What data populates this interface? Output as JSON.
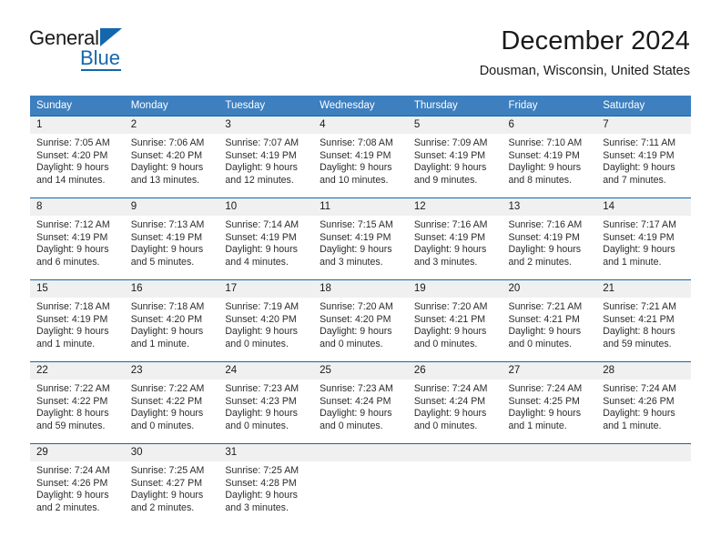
{
  "brand": {
    "name_top": "General",
    "name_bottom": "Blue",
    "accent_color": "#1567ac"
  },
  "header": {
    "title": "December 2024",
    "location": "Dousman, Wisconsin, United States"
  },
  "theme": {
    "header_row_bg": "#3d7fbf",
    "grid_line": "#1567ac",
    "daynum_bg": "#f0f0f0",
    "text": "#1a1a1a"
  },
  "weekdays": [
    "Sunday",
    "Monday",
    "Tuesday",
    "Wednesday",
    "Thursday",
    "Friday",
    "Saturday"
  ],
  "weeks": [
    [
      {
        "day": "1",
        "sunrise": "Sunrise: 7:05 AM",
        "sunset": "Sunset: 4:20 PM",
        "daylight1": "Daylight: 9 hours",
        "daylight2": "and 14 minutes."
      },
      {
        "day": "2",
        "sunrise": "Sunrise: 7:06 AM",
        "sunset": "Sunset: 4:20 PM",
        "daylight1": "Daylight: 9 hours",
        "daylight2": "and 13 minutes."
      },
      {
        "day": "3",
        "sunrise": "Sunrise: 7:07 AM",
        "sunset": "Sunset: 4:19 PM",
        "daylight1": "Daylight: 9 hours",
        "daylight2": "and 12 minutes."
      },
      {
        "day": "4",
        "sunrise": "Sunrise: 7:08 AM",
        "sunset": "Sunset: 4:19 PM",
        "daylight1": "Daylight: 9 hours",
        "daylight2": "and 10 minutes."
      },
      {
        "day": "5",
        "sunrise": "Sunrise: 7:09 AM",
        "sunset": "Sunset: 4:19 PM",
        "daylight1": "Daylight: 9 hours",
        "daylight2": "and 9 minutes."
      },
      {
        "day": "6",
        "sunrise": "Sunrise: 7:10 AM",
        "sunset": "Sunset: 4:19 PM",
        "daylight1": "Daylight: 9 hours",
        "daylight2": "and 8 minutes."
      },
      {
        "day": "7",
        "sunrise": "Sunrise: 7:11 AM",
        "sunset": "Sunset: 4:19 PM",
        "daylight1": "Daylight: 9 hours",
        "daylight2": "and 7 minutes."
      }
    ],
    [
      {
        "day": "8",
        "sunrise": "Sunrise: 7:12 AM",
        "sunset": "Sunset: 4:19 PM",
        "daylight1": "Daylight: 9 hours",
        "daylight2": "and 6 minutes."
      },
      {
        "day": "9",
        "sunrise": "Sunrise: 7:13 AM",
        "sunset": "Sunset: 4:19 PM",
        "daylight1": "Daylight: 9 hours",
        "daylight2": "and 5 minutes."
      },
      {
        "day": "10",
        "sunrise": "Sunrise: 7:14 AM",
        "sunset": "Sunset: 4:19 PM",
        "daylight1": "Daylight: 9 hours",
        "daylight2": "and 4 minutes."
      },
      {
        "day": "11",
        "sunrise": "Sunrise: 7:15 AM",
        "sunset": "Sunset: 4:19 PM",
        "daylight1": "Daylight: 9 hours",
        "daylight2": "and 3 minutes."
      },
      {
        "day": "12",
        "sunrise": "Sunrise: 7:16 AM",
        "sunset": "Sunset: 4:19 PM",
        "daylight1": "Daylight: 9 hours",
        "daylight2": "and 3 minutes."
      },
      {
        "day": "13",
        "sunrise": "Sunrise: 7:16 AM",
        "sunset": "Sunset: 4:19 PM",
        "daylight1": "Daylight: 9 hours",
        "daylight2": "and 2 minutes."
      },
      {
        "day": "14",
        "sunrise": "Sunrise: 7:17 AM",
        "sunset": "Sunset: 4:19 PM",
        "daylight1": "Daylight: 9 hours",
        "daylight2": "and 1 minute."
      }
    ],
    [
      {
        "day": "15",
        "sunrise": "Sunrise: 7:18 AM",
        "sunset": "Sunset: 4:19 PM",
        "daylight1": "Daylight: 9 hours",
        "daylight2": "and 1 minute."
      },
      {
        "day": "16",
        "sunrise": "Sunrise: 7:18 AM",
        "sunset": "Sunset: 4:20 PM",
        "daylight1": "Daylight: 9 hours",
        "daylight2": "and 1 minute."
      },
      {
        "day": "17",
        "sunrise": "Sunrise: 7:19 AM",
        "sunset": "Sunset: 4:20 PM",
        "daylight1": "Daylight: 9 hours",
        "daylight2": "and 0 minutes."
      },
      {
        "day": "18",
        "sunrise": "Sunrise: 7:20 AM",
        "sunset": "Sunset: 4:20 PM",
        "daylight1": "Daylight: 9 hours",
        "daylight2": "and 0 minutes."
      },
      {
        "day": "19",
        "sunrise": "Sunrise: 7:20 AM",
        "sunset": "Sunset: 4:21 PM",
        "daylight1": "Daylight: 9 hours",
        "daylight2": "and 0 minutes."
      },
      {
        "day": "20",
        "sunrise": "Sunrise: 7:21 AM",
        "sunset": "Sunset: 4:21 PM",
        "daylight1": "Daylight: 9 hours",
        "daylight2": "and 0 minutes."
      },
      {
        "day": "21",
        "sunrise": "Sunrise: 7:21 AM",
        "sunset": "Sunset: 4:21 PM",
        "daylight1": "Daylight: 8 hours",
        "daylight2": "and 59 minutes."
      }
    ],
    [
      {
        "day": "22",
        "sunrise": "Sunrise: 7:22 AM",
        "sunset": "Sunset: 4:22 PM",
        "daylight1": "Daylight: 8 hours",
        "daylight2": "and 59 minutes."
      },
      {
        "day": "23",
        "sunrise": "Sunrise: 7:22 AM",
        "sunset": "Sunset: 4:22 PM",
        "daylight1": "Daylight: 9 hours",
        "daylight2": "and 0 minutes."
      },
      {
        "day": "24",
        "sunrise": "Sunrise: 7:23 AM",
        "sunset": "Sunset: 4:23 PM",
        "daylight1": "Daylight: 9 hours",
        "daylight2": "and 0 minutes."
      },
      {
        "day": "25",
        "sunrise": "Sunrise: 7:23 AM",
        "sunset": "Sunset: 4:24 PM",
        "daylight1": "Daylight: 9 hours",
        "daylight2": "and 0 minutes."
      },
      {
        "day": "26",
        "sunrise": "Sunrise: 7:24 AM",
        "sunset": "Sunset: 4:24 PM",
        "daylight1": "Daylight: 9 hours",
        "daylight2": "and 0 minutes."
      },
      {
        "day": "27",
        "sunrise": "Sunrise: 7:24 AM",
        "sunset": "Sunset: 4:25 PM",
        "daylight1": "Daylight: 9 hours",
        "daylight2": "and 1 minute."
      },
      {
        "day": "28",
        "sunrise": "Sunrise: 7:24 AM",
        "sunset": "Sunset: 4:26 PM",
        "daylight1": "Daylight: 9 hours",
        "daylight2": "and 1 minute."
      }
    ],
    [
      {
        "day": "29",
        "sunrise": "Sunrise: 7:24 AM",
        "sunset": "Sunset: 4:26 PM",
        "daylight1": "Daylight: 9 hours",
        "daylight2": "and 2 minutes."
      },
      {
        "day": "30",
        "sunrise": "Sunrise: 7:25 AM",
        "sunset": "Sunset: 4:27 PM",
        "daylight1": "Daylight: 9 hours",
        "daylight2": "and 2 minutes."
      },
      {
        "day": "31",
        "sunrise": "Sunrise: 7:25 AM",
        "sunset": "Sunset: 4:28 PM",
        "daylight1": "Daylight: 9 hours",
        "daylight2": "and 3 minutes."
      },
      {
        "day": "",
        "sunrise": "",
        "sunset": "",
        "daylight1": "",
        "daylight2": ""
      },
      {
        "day": "",
        "sunrise": "",
        "sunset": "",
        "daylight1": "",
        "daylight2": ""
      },
      {
        "day": "",
        "sunrise": "",
        "sunset": "",
        "daylight1": "",
        "daylight2": ""
      },
      {
        "day": "",
        "sunrise": "",
        "sunset": "",
        "daylight1": "",
        "daylight2": ""
      }
    ]
  ]
}
